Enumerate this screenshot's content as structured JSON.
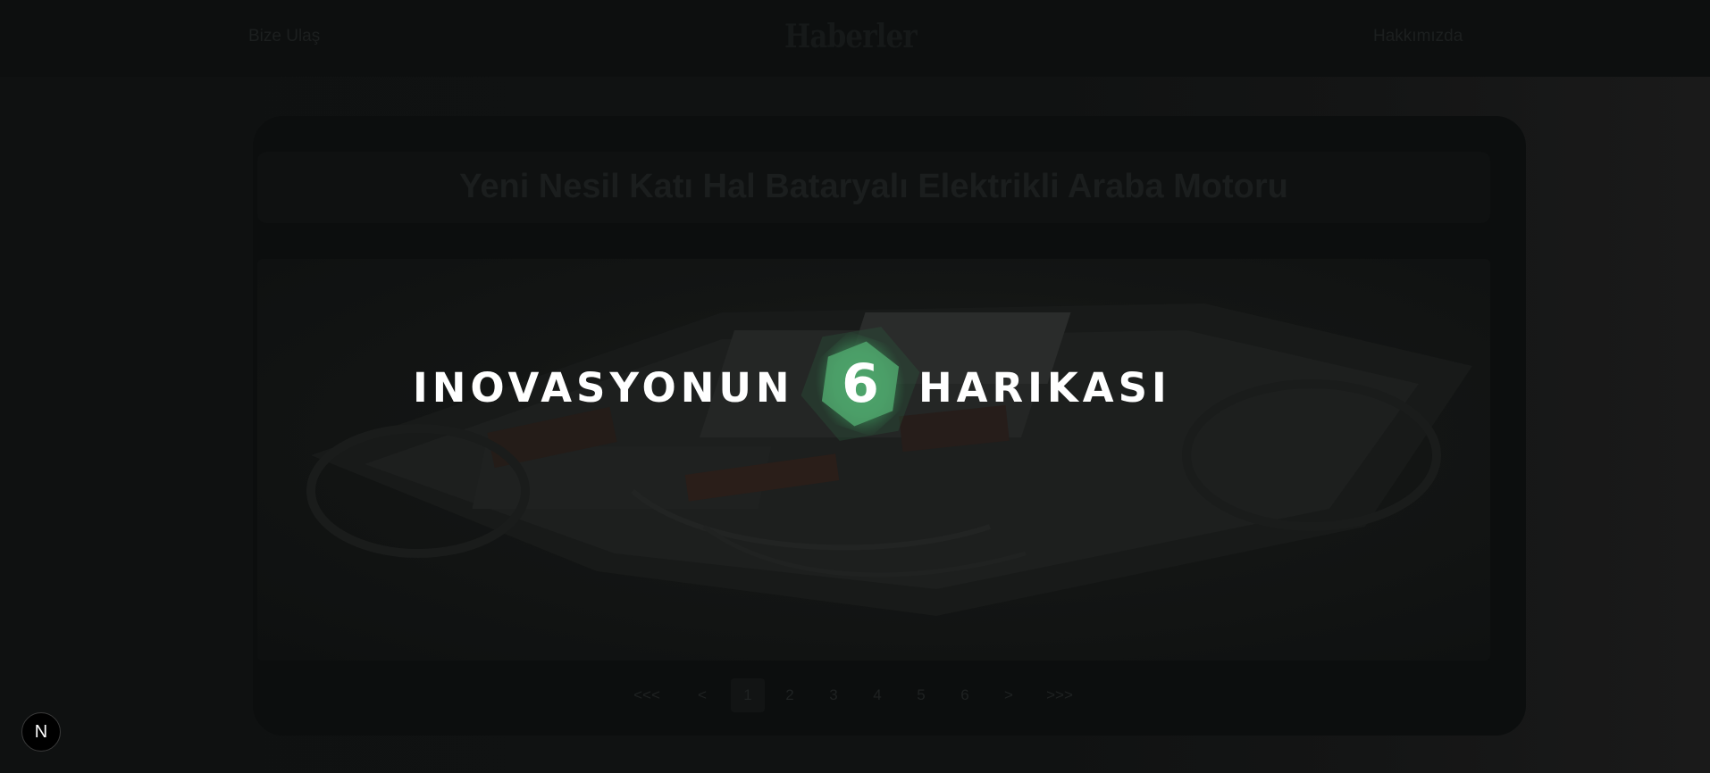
{
  "header": {
    "contact_label": "Bize Ulaş",
    "brand": "Haberler",
    "about_label": "Hakkımızda"
  },
  "article": {
    "title": "Yeni Nesil Katı Hal Bataryalı Elektrikli Araba Motoru",
    "image_icon": "car-chassis-image"
  },
  "pagination": {
    "first": "<<<",
    "prev": "<",
    "pages": [
      "1",
      "2",
      "3",
      "4",
      "5",
      "6"
    ],
    "active_page": "1",
    "next": ">",
    "last": ">>>"
  },
  "overlay": {
    "left_text": "INOVASYONUN",
    "number": "6",
    "right_text": "HARIKASI",
    "accent_color": "#4caf6d"
  },
  "badge": {
    "letter": "N",
    "icon": "nextjs-logo-icon"
  }
}
